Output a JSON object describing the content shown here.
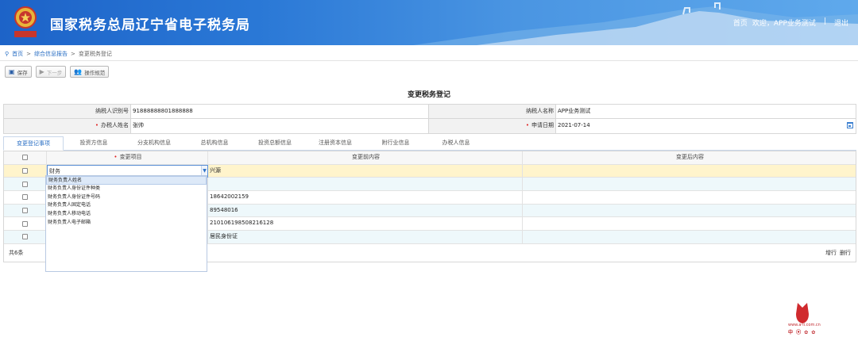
{
  "header": {
    "title": "国家税务总局辽宁省电子税务局",
    "emblem_text": "中国税务",
    "nav": {
      "home": "首页",
      "welcome": "欢迎，APP业务测试",
      "separator": "|",
      "logout": "退出"
    }
  },
  "breadcrumb": {
    "home": "首页",
    "sep": ">",
    "level1": "综合信息报告",
    "current": "变更税务登记"
  },
  "toolbar": {
    "save": "保存",
    "next": "下一步",
    "guide": "操作规范"
  },
  "form": {
    "title": "变更税务登记",
    "taxpayer_id_label": "纳税人识别号",
    "taxpayer_id": "91888888801888888",
    "taxpayer_name_label": "纳税人名称",
    "taxpayer_name": "APP业务测试",
    "handler_label": "办税人姓名",
    "handler": "张帅",
    "apply_date_label": "申请日期",
    "apply_date": "2021-07-14"
  },
  "tabs": [
    "变更登记事项",
    "投资方信息",
    "分支机构信息",
    "总机构信息",
    "投资总额信息",
    "注册资本信息",
    "附行业信息",
    "办税人信息"
  ],
  "grid": {
    "headers": {
      "item": "变更项目",
      "before": "变更前内容",
      "after": "变更后内容"
    },
    "rows": [
      {
        "item": "财务",
        "before": "兴源",
        "after": ""
      },
      {
        "item": "",
        "before": "",
        "after": ""
      },
      {
        "item": "",
        "before": "18642002159",
        "after": ""
      },
      {
        "item": "",
        "before": "89548016",
        "after": ""
      },
      {
        "item": "",
        "before": "210106198508216128",
        "after": ""
      },
      {
        "item": "",
        "before": "居民身份证",
        "after": ""
      }
    ],
    "total": "共6条",
    "add_row": "增行",
    "delete_row": "删行"
  },
  "dropdown": {
    "options": [
      "财务负责人姓名",
      "财务负责人身份证件种类",
      "财务负责人身份证件号码",
      "财务负责人固定电话",
      "财务负责人移动电话",
      "财务负责人电子邮箱"
    ],
    "highlighted_index": 0
  },
  "watermark": {
    "url": "www.a-li.com.cn"
  },
  "colors": {
    "header": "#2a78d6",
    "link": "#2a6fc4",
    "selected_row": "#fff4cc",
    "alt_row": "#eef8fb",
    "required": "#e02020"
  }
}
